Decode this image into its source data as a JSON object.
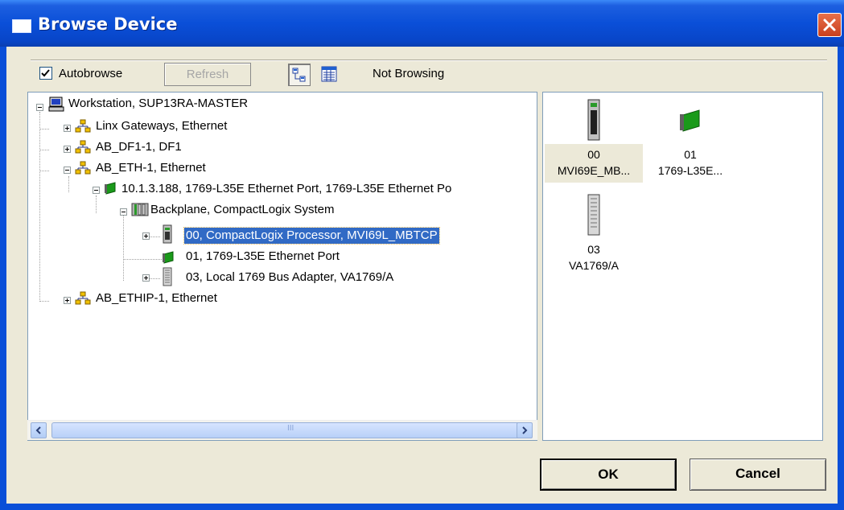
{
  "window": {
    "title": "Browse Device",
    "title_icon": "window-icon",
    "close_icon": "close-x-icon"
  },
  "toolbar": {
    "autobrowse_label": "Autobrowse",
    "autobrowse_checked": true,
    "refresh_label": "Refresh",
    "refresh_enabled": false,
    "view_tree_icon": "tree-view-icon",
    "view_list_icon": "list-view-icon",
    "status": "Not Browsing"
  },
  "tree": {
    "nodes": [
      {
        "label": "Workstation, SUP13RA-MASTER",
        "icon": "computer-icon",
        "expander": "minus"
      },
      {
        "label": "Linx Gateways, Ethernet",
        "icon": "network-icon",
        "expander": "plus"
      },
      {
        "label": "AB_DF1-1, DF1",
        "icon": "network-icon",
        "expander": "plus"
      },
      {
        "label": "AB_ETH-1, Ethernet",
        "icon": "network-icon",
        "expander": "minus"
      },
      {
        "label": "10.1.3.188, 1769-L35E Ethernet Port, 1769-L35E Ethernet Po",
        "icon": "ethernet-card-icon",
        "expander": "minus"
      },
      {
        "label": "Backplane, CompactLogix System",
        "icon": "backplane-icon",
        "expander": "minus"
      },
      {
        "label": "00, CompactLogix Processor, MVI69L_MBTCP",
        "icon": "processor-module-icon",
        "expander": "plus",
        "selected": true
      },
      {
        "label": "01, 1769-L35E Ethernet Port",
        "icon": "ethernet-card-icon",
        "expander": "none"
      },
      {
        "label": "03, Local 1769 Bus Adapter, VA1769/A",
        "icon": "io-module-icon",
        "expander": "plus"
      },
      {
        "label": "AB_ETHIP-1, Ethernet",
        "icon": "network-icon",
        "expander": "plus"
      }
    ],
    "hscroll_left_icon": "scroll-left-icon",
    "hscroll_right_icon": "scroll-right-icon",
    "hscroll_grip": "III"
  },
  "icon_view": {
    "tiles": [
      {
        "slot": "00",
        "name": "MVI69E_MB...",
        "icon": "processor-module-icon",
        "selected": true
      },
      {
        "slot": "01",
        "name": "1769-L35E...",
        "icon": "ethernet-card-icon"
      },
      {
        "slot": "03",
        "name": "VA1769/A",
        "icon": "io-module-icon"
      }
    ]
  },
  "buttons": {
    "ok": "OK",
    "cancel": "Cancel"
  },
  "colors": {
    "titlebar": "#0a4fd8",
    "selection": "#316ac5",
    "dialog_bg": "#ece9d8"
  }
}
